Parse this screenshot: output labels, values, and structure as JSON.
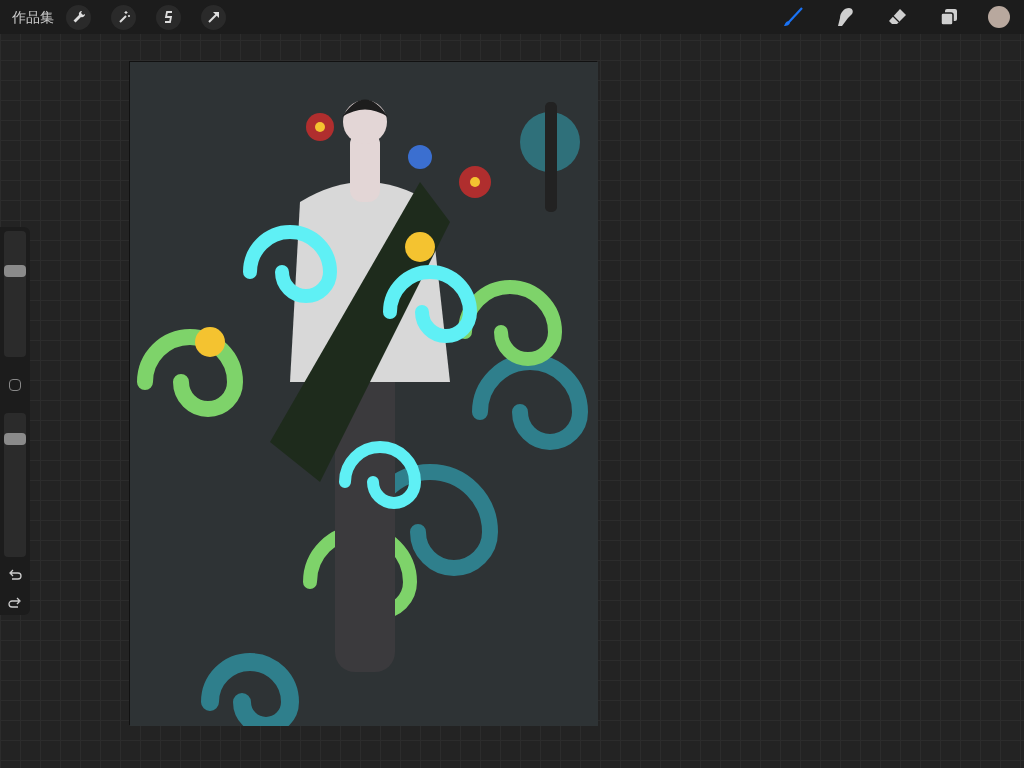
{
  "top_bar": {
    "gallery": "作品集",
    "actions": [
      {
        "kind": "wrench"
      },
      {
        "kind": "wand"
      },
      {
        "kind": "selection"
      },
      {
        "kind": "arrow"
      }
    ],
    "tools": [
      {
        "kind": "brush",
        "selected": true
      },
      {
        "kind": "smudge",
        "selected": false
      },
      {
        "kind": "eraser",
        "selected": false
      },
      {
        "kind": "layers",
        "selected": false
      }
    ],
    "current_color": {
      "color": "#b8a89e"
    }
  },
  "sidebar": {
    "size_slider": {
      "level": 0.7
    },
    "opacity_slider": {
      "level": 0.85
    }
  }
}
